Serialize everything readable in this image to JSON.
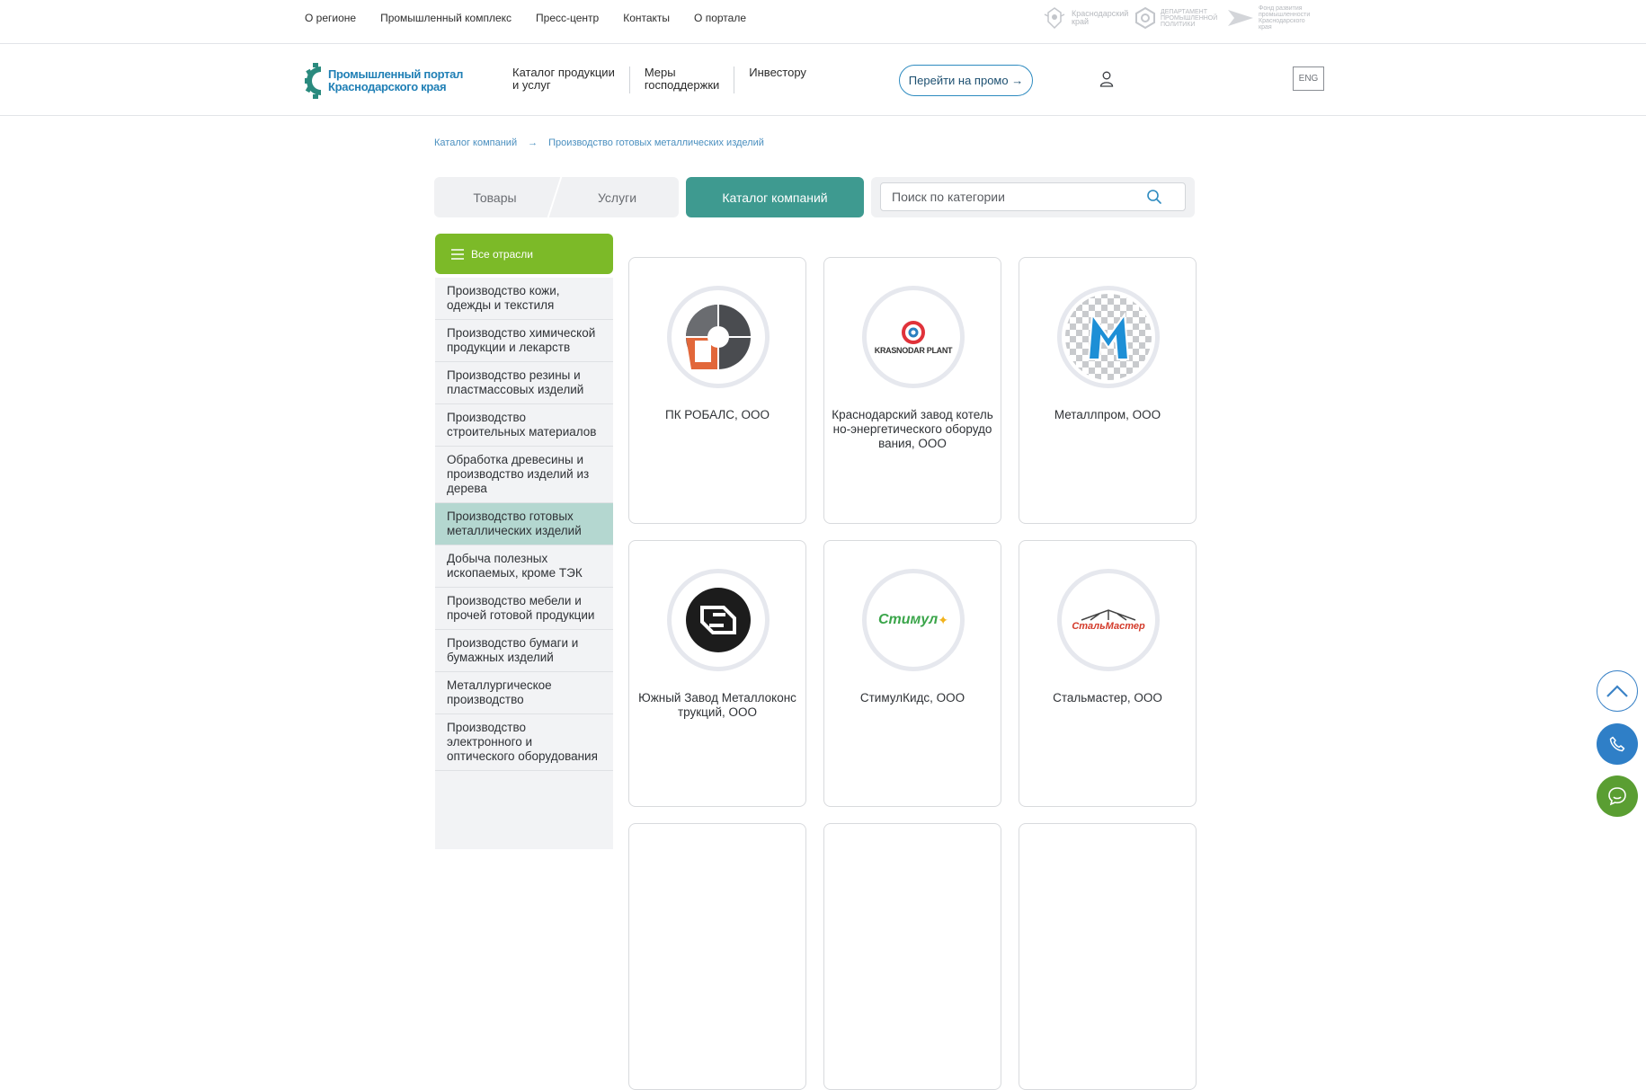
{
  "topnav": {
    "items": [
      "О регионе",
      "Промышленный комплекс",
      "Пресс-центр",
      "Контакты",
      "О портале"
    ]
  },
  "partners": [
    {
      "name": "Краснодарский край",
      "icon": "coat-of-arms-icon"
    },
    {
      "name": "ДЕПАРТАМЕНТ ПРОМЫШЛЕННОЙ ПОЛИТИКИ",
      "icon": "department-logo-icon"
    },
    {
      "name": "Фонд развития промышленности Краснодарского края",
      "icon": "fund-logo-icon"
    }
  ],
  "header": {
    "logo_line1": "Промышленный портал",
    "logo_line2": "Краснодарского края",
    "nav": [
      {
        "line1": "Каталог продукции",
        "line2": "и услуг"
      },
      {
        "line1": "Меры",
        "line2": "господдержки"
      },
      {
        "line1": "Инвестору",
        "line2": ""
      }
    ],
    "promo_label": "Перейти на промо →",
    "lang_label": "ENG"
  },
  "breadcrumb": {
    "items": [
      "Каталог компаний",
      "Производство готовых металлических изделий"
    ],
    "separator": "→"
  },
  "tabs": {
    "goods": "Товары",
    "services": "Услуги",
    "catalog": "Каталог компаний"
  },
  "search": {
    "placeholder": "Поиск по категории",
    "value": ""
  },
  "sidebar": {
    "all_label": "Все отрасли",
    "items": [
      "Производство кожи, одежды и текстиля",
      "Производство химической продукции и лекарств",
      "Производство резины и пластмассовых изделий",
      "Производство строительных материалов",
      "Обработка древесины и производство изделий из дерева",
      "Производство готовых металлических изделий",
      "Добыча полезных ископаемых, кроме ТЭК",
      "Производство мебели и прочей готовой продукции",
      "Производство бумаги и бумажных изделий",
      "Металлургическое производство",
      "Производство электронного и оптического оборудования"
    ],
    "active_index": 5
  },
  "companies": [
    {
      "name": "ПК РОБАЛС, ООО",
      "logo": "robals-logo-icon"
    },
    {
      "name": "Краснодарский завод котельно-энергетического оборудования, ООО",
      "logo": "krasnodar-plant-logo-icon",
      "logo_text": "KRASNODAR PLANT"
    },
    {
      "name": "Металлпром, ООО",
      "logo": "metallprom-logo-icon"
    },
    {
      "name": "Южный Завод Металлоконструкций, ООО",
      "logo": "yuzhny-zavod-logo-icon"
    },
    {
      "name": "СтимулКидс, ООО",
      "logo": "stimulkids-logo-icon",
      "logo_text": "Стимул"
    },
    {
      "name": "Стальмастер, ООО",
      "logo": "stalmaster-logo-icon",
      "logo_text": "СтальМастер"
    }
  ],
  "colors": {
    "accent_teal": "#3e9a90",
    "accent_green": "#7cba28",
    "brand_blue": "#1f7fb5",
    "active_sidebar": "#b4d7d0"
  }
}
